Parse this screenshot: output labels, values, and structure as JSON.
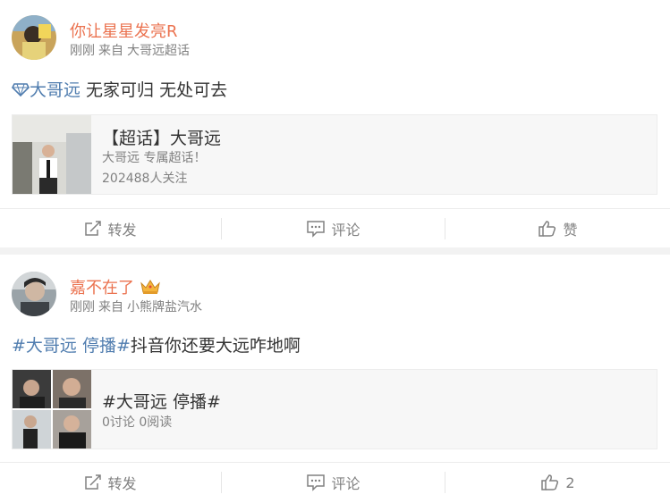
{
  "posts": [
    {
      "user": "你让星星发亮R",
      "meta": {
        "time": "刚刚",
        "from_prefix": "来自",
        "source": "大哥远超话"
      },
      "content": {
        "link": "大哥远",
        "text": " 无家可归 无处可去",
        "link_icon": "diamond-icon"
      },
      "card": {
        "title": "【超话】大哥远",
        "subtitle": "大哥远 专属超话！",
        "info": "202488人关注"
      },
      "actions": {
        "repost": "转发",
        "comment": "评论",
        "like": "赞"
      }
    },
    {
      "user": "嘉不在了",
      "user_badge": "crown-icon",
      "meta": {
        "time": "刚刚",
        "from_prefix": "来自",
        "source": "小熊牌盐汽水"
      },
      "content": {
        "link": "#大哥远 停播#",
        "text": "抖音你还要大远咋地啊"
      },
      "card": {
        "title": "#大哥远 停播#",
        "info": "0讨论 0阅读"
      },
      "actions": {
        "repost": "转发",
        "comment": "评论",
        "like": "2"
      }
    }
  ],
  "colors": {
    "name": "#eb7350",
    "link": "#507daf",
    "meta": "#808080",
    "background": "#f2f2f2"
  }
}
